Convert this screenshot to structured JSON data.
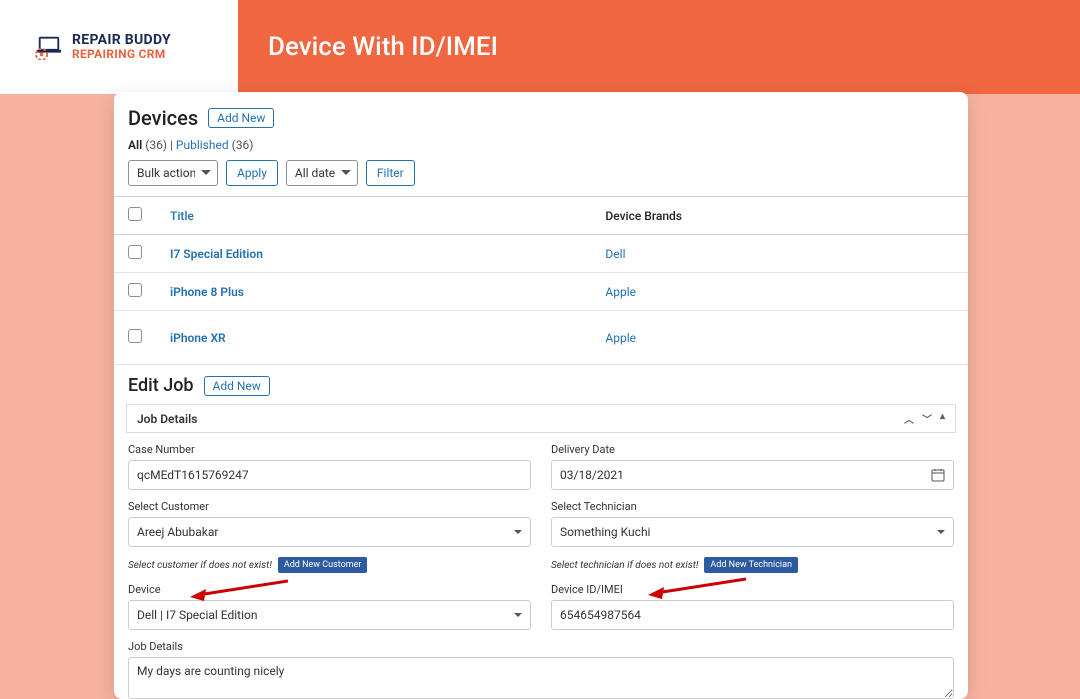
{
  "logo": {
    "top": "REPAIR BUDDY",
    "bottom": "REPAIRING CRM"
  },
  "header": {
    "title": "Device With ID/IMEI"
  },
  "devices": {
    "heading": "Devices",
    "addNew": "Add New",
    "status": {
      "allLabel": "All",
      "allCount": "(36)",
      "sep": " | ",
      "publishedLabel": "Published",
      "publishedCount": "(36)"
    },
    "toolbar": {
      "bulk": "Bulk actions",
      "apply": "Apply",
      "allDates": "All dates",
      "filter": "Filter"
    },
    "columns": {
      "title": "Title",
      "brands": "Device Brands"
    },
    "rows": [
      {
        "title": "I7 Special Edition",
        "brand": "Dell"
      },
      {
        "title": "iPhone 8 Plus",
        "brand": "Apple"
      },
      {
        "title": "iPhone XR",
        "brand": "Apple"
      }
    ]
  },
  "editJob": {
    "heading": "Edit Job",
    "addNew": "Add New",
    "detailsHdr": "Job Details",
    "fields": {
      "caseNumberLabel": "Case Number",
      "caseNumber": "qcMEdT1615769247",
      "deliveryDateLabel": "Delivery Date",
      "deliveryDate": "03/18/2021",
      "selectCustomerLabel": "Select Customer",
      "selectCustomer": "Areej Abubakar",
      "selectTechnicianLabel": "Select Technician",
      "selectTechnician": "Something Kuchi",
      "helperCustomer": "Select customer if does not exist!",
      "addCustomer": "Add New Customer",
      "helperTechnician": "Select technician if does not exist!",
      "addTechnician": "Add New Technician",
      "deviceLabel": "Device",
      "device": "Dell | I7 Special Edition",
      "deviceIdLabel": "Device ID/IMEI",
      "deviceId": "654654987564",
      "jobDetailsLabel": "Job Details",
      "jobDetails": "My days are counting nicely"
    }
  }
}
